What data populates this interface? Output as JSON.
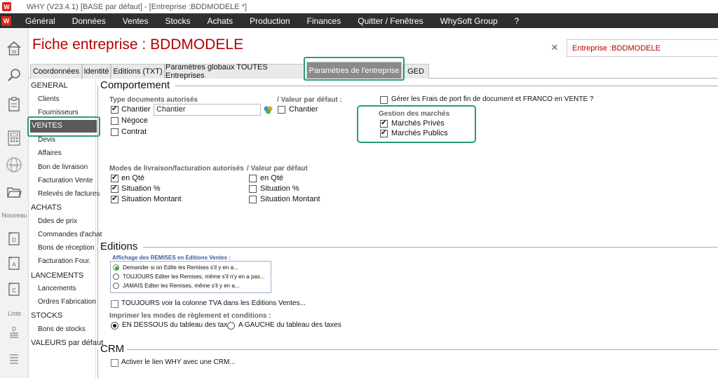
{
  "titlebar": {
    "logo": "W",
    "title": "WHY (V23.4.1)  [BASE par défaut] - [Entreprise :BDDMODELE *]"
  },
  "menu": {
    "logo": "W",
    "items": [
      "Général",
      "Données",
      "Ventes",
      "Stocks",
      "Achats",
      "Production",
      "Finances",
      "Quitter / Fenêtres",
      "WhySoft Group",
      "?"
    ]
  },
  "leftbar": {
    "label_nouveau": "Nouveau",
    "label_liste": "Liste",
    "icons": [
      "home-icon",
      "search-icon",
      "clipboard-icon",
      "calculator-icon",
      "globe-icon",
      "folder-icon",
      "new-d-icon",
      "new-a-icon",
      "new-c-icon",
      "list-d-icon",
      "list-icon"
    ]
  },
  "header": {
    "title": "Fiche entreprise : BDDMODELE",
    "close": "×",
    "entity_field": "Entreprise :BDDMODELE"
  },
  "tabs": [
    "Coordonnées",
    "Identité",
    "Editions (TXT)",
    "Paramètres globaux TOUTES Entreprises",
    "Paramètres de l'entreprise",
    "GED"
  ],
  "nav": {
    "general": "GENERAL",
    "clients": "Clients",
    "fournisseurs": "Fournisseurs",
    "ventes": "VENTES",
    "devis": "Devis",
    "affaires": "Affaires",
    "bon_livraison": "Bon de livraison",
    "facturation_vente": "Facturation Vente",
    "releves": "Relevés de factures",
    "achats": "ACHATS",
    "ddes_prix": "Ddes de prix",
    "commandes_achat": "Commandes d'achat",
    "bons_reception": "Bons de réception",
    "facturation_four": "Facturation Four.",
    "lancements_cat": "LANCEMENTS",
    "lancements": "Lancements",
    "ordres_fab": "Ordres Fabrication",
    "stocks_cat": "STOCKS",
    "bons_stocks": "Bons de stocks",
    "valeurs": "VALEURS par défaut"
  },
  "comportement": {
    "title": "Comportement",
    "types_label": "Type documents autorisés",
    "chantier": "Chantier",
    "chantier_value": "Chantier",
    "negoce": "Négoce",
    "contrat": "Contrat",
    "valeur_defaut_label": "/ Valeur par défaut :",
    "valeur_chantier": "Chantier",
    "frais_port": "Gérer les Frais de port fin de document et FRANCO en VENTE ?",
    "gestion_marches": "Gestion des marchés",
    "marches_prives": "Marchés Privés",
    "marches_publics": "Marchés Publics",
    "modes_label": "Modes de livraison/facturation autorisés",
    "modes_defaut_label": "/ Valeur par défaut",
    "en_qte": "en Qté",
    "situation_pct": "Situation %",
    "situation_montant": "Situation Montant"
  },
  "editions": {
    "title": "Editions",
    "remises_title": "Affichage des REMISES en Editions Ventes :",
    "rem1": "Demander si on Edite les Remises s'il y en a...",
    "rem2": "TOUJOURS Editer les Remises, même s'il n'y en a pas...",
    "rem3": "JAMAIS Editer les Remises, même s'il y en a...",
    "tva": "TOUJOURS voir la colonne TVA dans les Editions Ventes...",
    "reglement_label": "Imprimer les modes de règlement et conditions :",
    "en_dessous": "EN DESSOUS du tableau des taxes",
    "a_gauche": "A GAUCHE du tableau des taxes"
  },
  "crm": {
    "title": "CRM",
    "lien": "Activer le lien WHY avec une CRM..."
  },
  "colors": {
    "accent_red": "#b30000",
    "highlight_green": "#2a9d72",
    "menubar": "#2f2f2f"
  }
}
